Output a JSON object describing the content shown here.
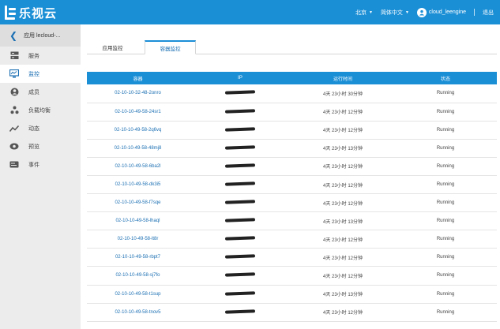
{
  "header": {
    "logo_text": "乐视云",
    "region": "北京",
    "language": "简体中文",
    "username": "cloud_leengine",
    "logout": "退出"
  },
  "sidebar": {
    "back_label": "应用 lecloud-...",
    "items": [
      {
        "label": "服务",
        "icon": "server-icon"
      },
      {
        "label": "监控",
        "icon": "monitor-icon",
        "active": true
      },
      {
        "label": "成员",
        "icon": "member-icon"
      },
      {
        "label": "负载均衡",
        "icon": "load-balance-icon"
      },
      {
        "label": "动态",
        "icon": "activity-icon"
      },
      {
        "label": "预览",
        "icon": "eye-icon"
      },
      {
        "label": "事件",
        "icon": "event-icon"
      }
    ]
  },
  "tabs": [
    {
      "label": "应用监控",
      "active": false
    },
    {
      "label": "容器监控",
      "active": true
    }
  ],
  "table": {
    "columns": [
      "容器",
      "IP",
      "运行时间",
      "状态"
    ],
    "rows": [
      {
        "name": "02-10-10-32-48-2onro",
        "uptime": "4天 23小时 30分钟",
        "status": "Running"
      },
      {
        "name": "02-10-10-49-58-24sr1",
        "uptime": "4天 23小时 12分钟",
        "status": "Running"
      },
      {
        "name": "02-10-10-49-58-2q6vq",
        "uptime": "4天 23小时 12分钟",
        "status": "Running"
      },
      {
        "name": "02-10-10-49-58-48mj8",
        "uptime": "4天 23小时 13分钟",
        "status": "Running"
      },
      {
        "name": "02-10-10-49-58-6ba2l",
        "uptime": "4天 23小时 12分钟",
        "status": "Running"
      },
      {
        "name": "02-10-10-49-58-dk3i5",
        "uptime": "4天 23小时 12分钟",
        "status": "Running"
      },
      {
        "name": "02-10-10-49-58-f7sqe",
        "uptime": "4天 23小时 12分钟",
        "status": "Running"
      },
      {
        "name": "02-10-10-49-58-lhaql",
        "uptime": "4天 23小时 13分钟",
        "status": "Running"
      },
      {
        "name": "02-10-10-49-58-lt8r",
        "uptime": "4天 23小时 12分钟",
        "status": "Running"
      },
      {
        "name": "02-10-10-49-58-rbpt7",
        "uptime": "4天 23小时 12分钟",
        "status": "Running"
      },
      {
        "name": "02-10-10-49-58-sj7fo",
        "uptime": "4天 23小时 12分钟",
        "status": "Running"
      },
      {
        "name": "02-10-10-49-58-t1sup",
        "uptime": "4天 23小时 13分钟",
        "status": "Running"
      },
      {
        "name": "02-10-10-49-58-tnov5",
        "uptime": "4天 23小时 12分钟",
        "status": "Running"
      }
    ]
  }
}
